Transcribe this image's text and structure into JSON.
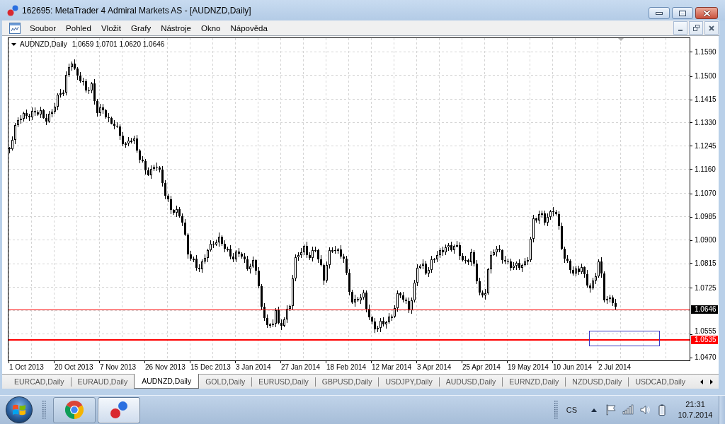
{
  "window": {
    "title": "162695: MetaTrader 4 Admiral Markets AS - [AUDNZD,Daily]"
  },
  "menu": {
    "items": [
      "Soubor",
      "Pohled",
      "Vložit",
      "Grafy",
      "Nástroje",
      "Okno",
      "Nápověda"
    ]
  },
  "chart": {
    "symbol": "AUDNZD,Daily",
    "ohlc": "1.0659 1.0701 1.0620 1.0646",
    "price_labels": [
      "1.1590",
      "1.1500",
      "1.1415",
      "1.1330",
      "1.1245",
      "1.1160",
      "1.1070",
      "1.0985",
      "1.0900",
      "1.0815",
      "1.0725",
      "1.0555",
      "1.0470"
    ],
    "levels": [
      {
        "kind": "bid",
        "label": "1.0646"
      },
      {
        "kind": "line",
        "label": "1.0535"
      }
    ],
    "date_labels": [
      "1 Oct 2013",
      "20 Oct 2013",
      "7 Nov 2013",
      "26 Nov 2013",
      "15 Dec 2013",
      "3 Jan 2014",
      "27 Jan 2014",
      "18 Feb 2014",
      "12 Mar 2014",
      "3 Apr 2014",
      "25 Apr 2014",
      "19 May 2014",
      "10 Jun 2014",
      "2 Jul 2014"
    ]
  },
  "tabs": [
    {
      "label": "EURCAD,Daily",
      "selected": false
    },
    {
      "label": "EURAUD,Daily",
      "selected": false
    },
    {
      "label": "AUDNZD,Daily",
      "selected": true
    },
    {
      "label": "GOLD,Daily",
      "selected": false
    },
    {
      "label": "EURUSD,Daily",
      "selected": false
    },
    {
      "label": "GBPUSD,Daily",
      "selected": false
    },
    {
      "label": "USDJPY,Daily",
      "selected": false
    },
    {
      "label": "AUDUSD,Daily",
      "selected": false
    },
    {
      "label": "EURNZD,Daily",
      "selected": false
    },
    {
      "label": "NZDUSD,Daily",
      "selected": false
    },
    {
      "label": "USDCAD,Daily",
      "selected": false
    }
  ],
  "taskbar": {
    "apps": [
      {
        "kind": "browser",
        "selected": false
      },
      {
        "kind": "trader",
        "selected": true
      }
    ],
    "language": "CS",
    "clock": {
      "time": "21:31",
      "date": "10.7.2014"
    }
  }
}
